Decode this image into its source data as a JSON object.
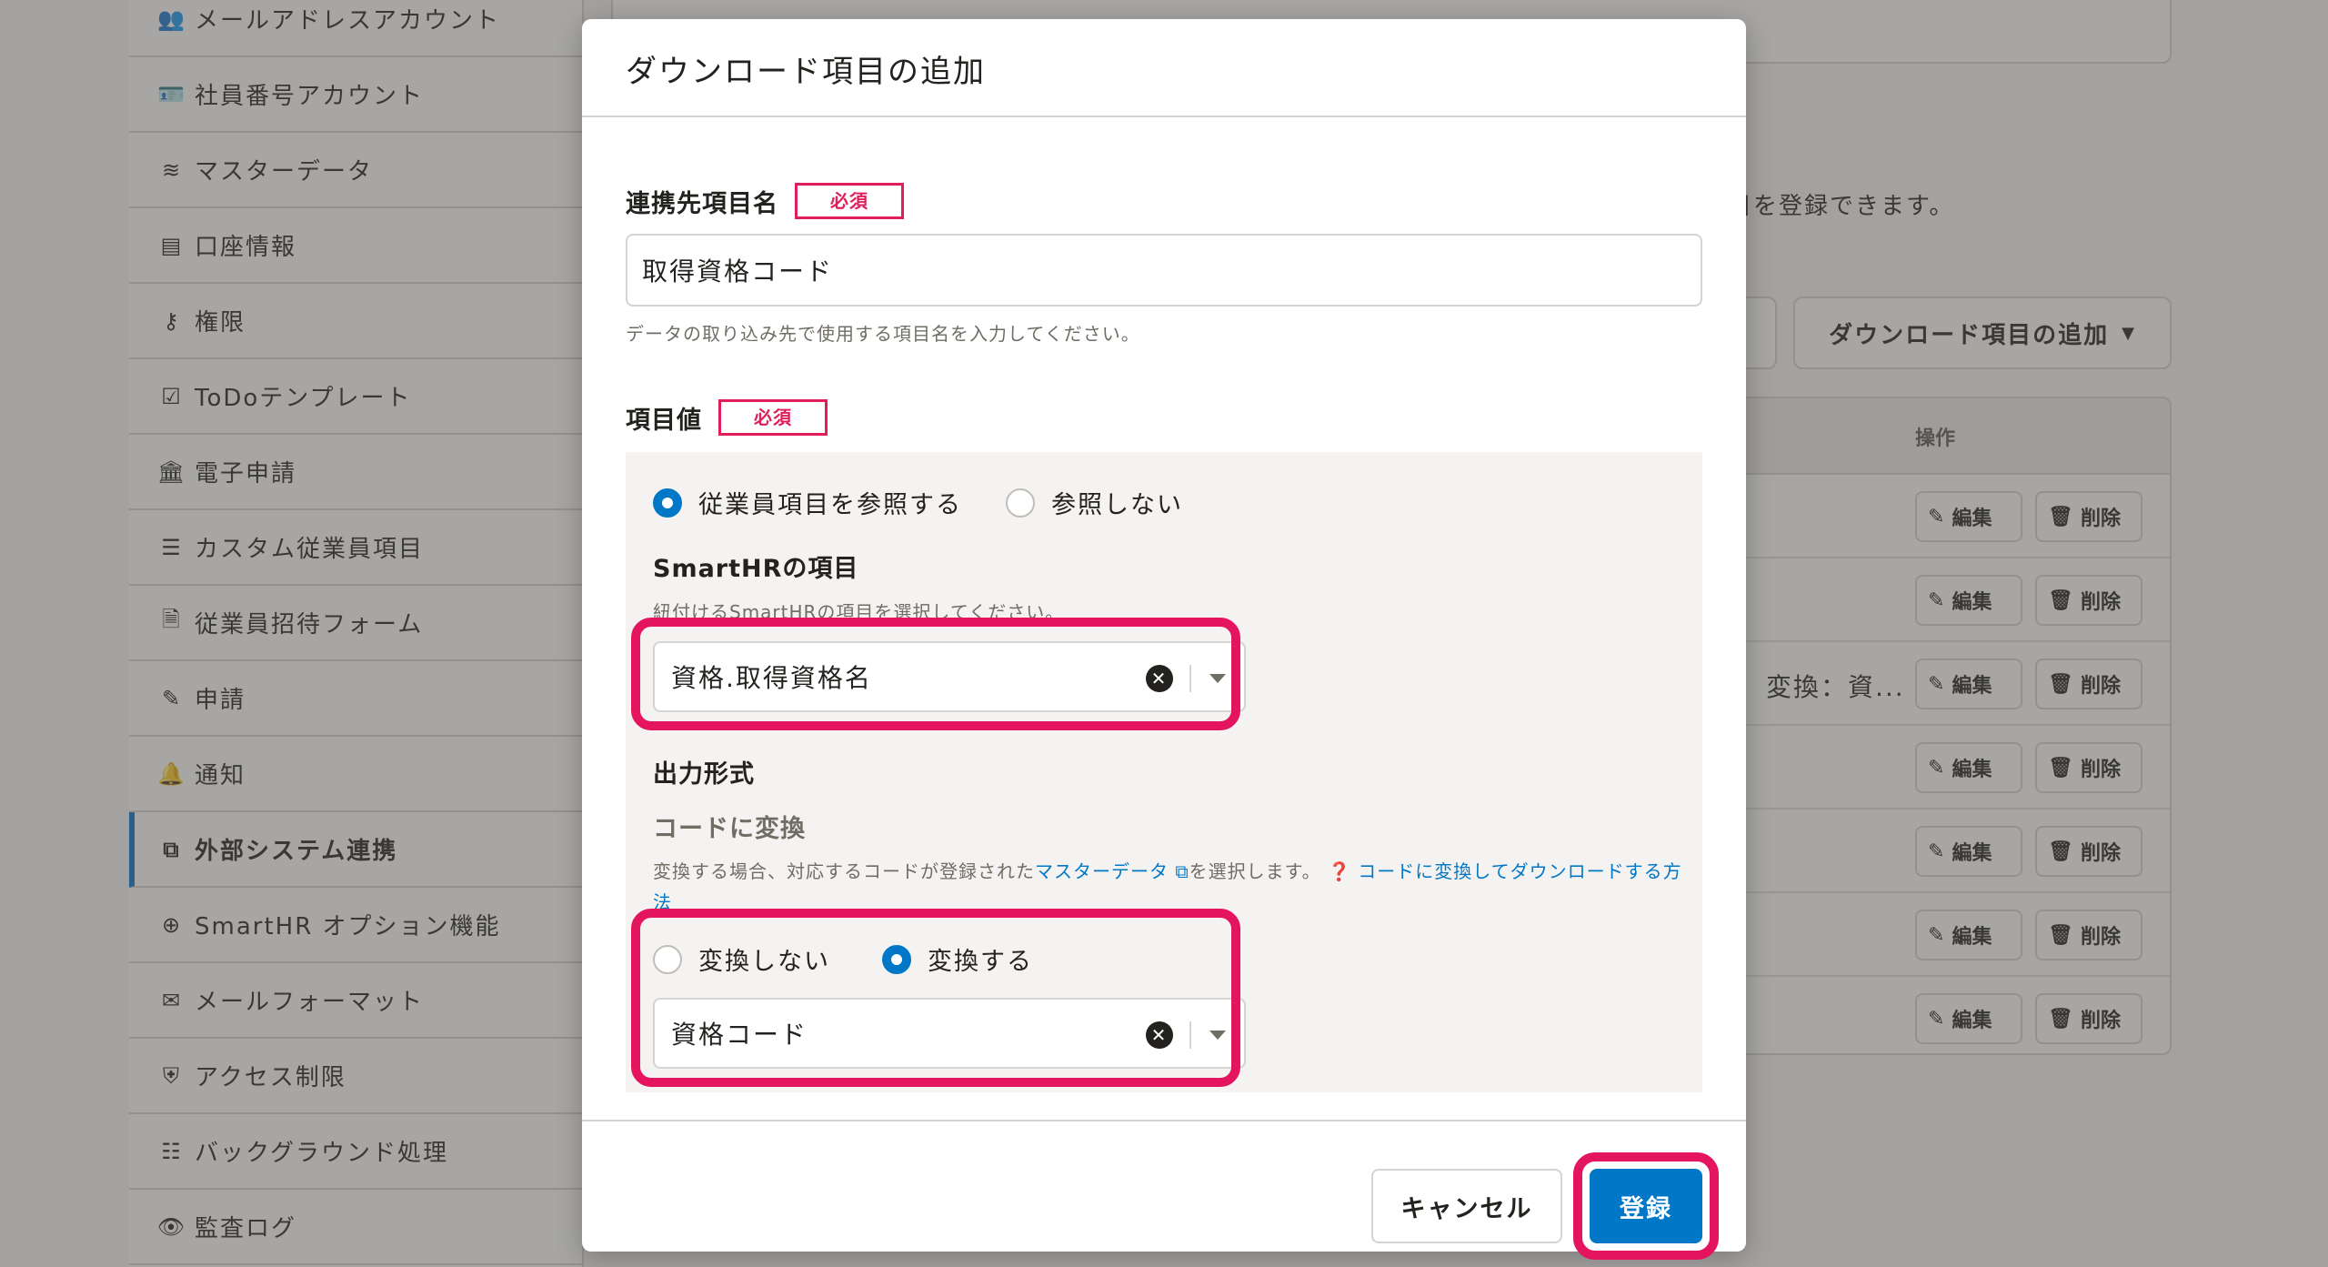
{
  "sidebar": {
    "items": [
      {
        "label": "メールアドレスアカウント",
        "icon": "users-icon",
        "glyph": "👥"
      },
      {
        "label": "社員番号アカウント",
        "icon": "id-card-icon",
        "glyph": "🪪"
      },
      {
        "label": "マスターデータ",
        "icon": "database-icon",
        "glyph": "≋"
      },
      {
        "label": "口座情報",
        "icon": "credit-card-icon",
        "glyph": "▤"
      },
      {
        "label": "権限",
        "icon": "user-key-icon",
        "glyph": "⚷"
      },
      {
        "label": "ToDoテンプレート",
        "icon": "checkbox-icon",
        "glyph": "☑"
      },
      {
        "label": "電子申請",
        "icon": "building-icon",
        "glyph": "🏛"
      },
      {
        "label": "カスタム従業員項目",
        "icon": "list-icon",
        "glyph": "☰"
      },
      {
        "label": "従業員招待フォーム",
        "icon": "document-icon",
        "glyph": "🗎"
      },
      {
        "label": "申請",
        "icon": "form-edit-icon",
        "glyph": "✎"
      },
      {
        "label": "通知",
        "icon": "bell-icon",
        "glyph": "🔔"
      },
      {
        "label": "外部システム連携",
        "icon": "cubes-icon",
        "glyph": "⧉"
      },
      {
        "label": "SmartHR オプション機能",
        "icon": "plus-circle-icon",
        "glyph": "⊕"
      },
      {
        "label": "メールフォーマット",
        "icon": "mail-icon",
        "glyph": "✉"
      },
      {
        "label": "アクセス制限",
        "icon": "shield-icon",
        "glyph": "⛨"
      },
      {
        "label": "バックグラウンド処理",
        "icon": "list-ol-icon",
        "glyph": "☷"
      },
      {
        "label": "監査ログ",
        "icon": "eye-icon",
        "glyph": "👁"
      }
    ],
    "active_index": 11
  },
  "background": {
    "description": "目を登録できます。",
    "add_button_label": "ダウンロード項目の追加",
    "table_header_action": "操作",
    "row_partial_text": "変換：資...",
    "edit_label": "編集",
    "delete_label": "削除",
    "row_count": 7
  },
  "dialog": {
    "title": "ダウンロード項目の追加",
    "field_name": {
      "label": "連携先項目名",
      "required_badge": "必須",
      "value": "取得資格コード",
      "help": "データの取り込み先で使用する項目名を入力してください。"
    },
    "field_value": {
      "label": "項目値",
      "required_badge": "必須",
      "radio_reference": "従業員項目を参照する",
      "radio_no_reference": "参照しない",
      "selected": "reference",
      "smarthr_title": "SmartHRの項目",
      "smarthr_help": "紐付けるSmartHRの項目を選択してください。",
      "smarthr_select_value": "資格.取得資格名",
      "output_title": "出力形式",
      "convert_title": "コードに変換",
      "convert_help_prefix": "変換する場合、対応するコードが登録された",
      "convert_help_link": "マスターデータ",
      "convert_help_suffix": "を選択します。",
      "convert_help_link2": "コードに変換してダウンロードする方法",
      "radio_no_convert": "変換しない",
      "radio_convert": "変換する",
      "convert_selected": "convert",
      "master_select_value": "資格コード"
    },
    "cancel_label": "キャンセル",
    "submit_label": "登録"
  },
  "colors": {
    "accent": "#0077c7",
    "highlight": "#e5145e",
    "required": "#e01e5a"
  }
}
